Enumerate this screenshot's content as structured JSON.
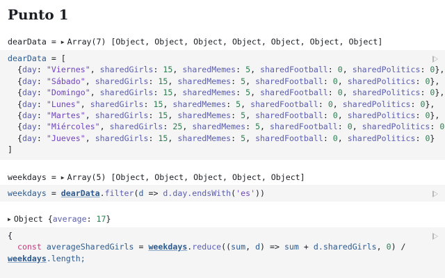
{
  "heading": "Punto 1",
  "output1": {
    "name": "dearData",
    "summary": "Array(7) [Object, Object, Object, Object, Object, Object, Object]"
  },
  "cell1": {
    "assign": "dearData",
    "rows": [
      {
        "day": "\"Viernes\"",
        "sharedGirls": "15",
        "sharedMemes": "5",
        "sharedFootball": "0",
        "sharedPolitics": "0",
        "end": "},"
      },
      {
        "day": "\"Sábado\"",
        "sharedGirls": "15",
        "sharedMemes": "5",
        "sharedFootball": "0",
        "sharedPolitics": "0",
        "end": "},"
      },
      {
        "day": "\"Domingo\"",
        "sharedGirls": "15",
        "sharedMemes": "5",
        "sharedFootball": "0",
        "sharedPolitics": "0",
        "end": "},"
      },
      {
        "day": "\"Lunes\"",
        "sharedGirls": "15",
        "sharedMemes": "5",
        "sharedFootball": "0",
        "sharedPolitics": "0",
        "end": "},"
      },
      {
        "day": "\"Martes\"",
        "sharedGirls": "15",
        "sharedMemes": "5",
        "sharedFootball": "0",
        "sharedPolitics": "0",
        "end": "},"
      },
      {
        "day": "\"Miércoles\"",
        "sharedGirls": "25",
        "sharedMemes": "5",
        "sharedFootball": "0",
        "sharedPolitics": "0",
        "end": "},"
      },
      {
        "day": "\"Jueves\"",
        "sharedGirls": "15",
        "sharedMemes": "5",
        "sharedFootball": "0",
        "sharedPolitics": "0",
        "end": "}"
      }
    ]
  },
  "output2": {
    "name": "weekdays",
    "summary": "Array(5) [Object, Object, Object, Object, Object]"
  },
  "cell2": {
    "assign": "weekdays",
    "source": "dearData",
    "method": "filter",
    "param": "d",
    "prop": "d.day.endsWith",
    "arg": "'es'"
  },
  "output3": {
    "label": "Object",
    "key": "average",
    "value": "17"
  },
  "cell3": {
    "line1_open": "{",
    "keyword": "const",
    "varname": "averageSharedGirls",
    "ref": "weekdays",
    "method": "reduce",
    "acc": "sum",
    "param": "d",
    "expr_a": "sum",
    "expr_b": "d.sharedGirls",
    "initial": "0",
    "ref2": "weekdays",
    "tail": ".length;"
  },
  "icons": {
    "expand": "disclosure-triangle-icon",
    "run": "run-cell-icon"
  }
}
